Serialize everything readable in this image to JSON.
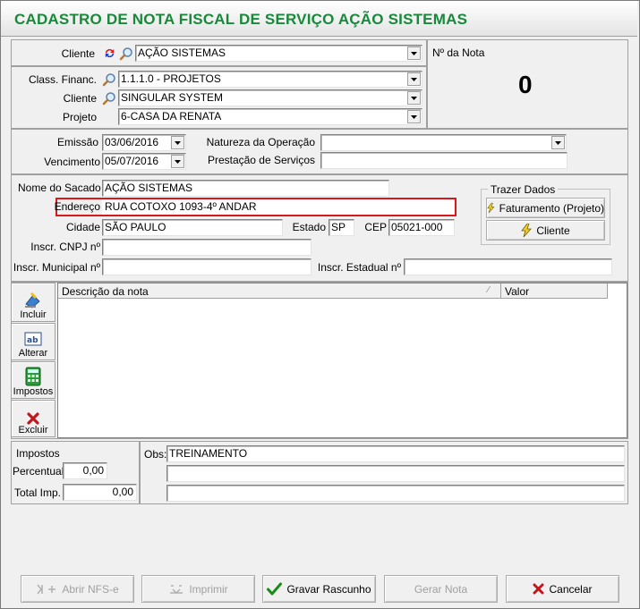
{
  "window": {
    "title": "CADASTRO DE NOTA FISCAL DE SERVIÇO AÇÃO SISTEMAS"
  },
  "header": {
    "cliente_label": "Cliente",
    "cliente_value": "AÇÃO SISTEMAS",
    "nota_label": "Nº da Nota",
    "nota_value": "0"
  },
  "classification": {
    "class_financ_label": "Class. Financ.",
    "class_financ_value": "1.1.1.0 - PROJETOS",
    "cliente_label": "Cliente",
    "cliente_value": "SINGULAR SYSTEM",
    "projeto_label": "Projeto",
    "projeto_value": "6-CASA DA RENATA"
  },
  "dates": {
    "emissao_label": "Emissão",
    "emissao_value": "03/06/2016",
    "vencimento_label": "Vencimento",
    "vencimento_value": "05/07/2016",
    "natureza_label": "Natureza da Operação",
    "natureza_value": "",
    "prestacao_label": "Prestação de Serviços",
    "prestacao_value": ""
  },
  "sacado": {
    "nome_label": "Nome do Sacado",
    "nome_value": "AÇÃO SISTEMAS",
    "endereco_label": "Endereço",
    "endereco_value": "RUA COTOXO 1093-4º ANDAR",
    "cidade_label": "Cidade",
    "cidade_value": "SÃO PAULO",
    "estado_label": "Estado",
    "estado_value": "SP",
    "cep_label": "CEP",
    "cep_value": "05021-000",
    "cnpj_label": "Inscr. CNPJ nº",
    "cnpj_value": "",
    "municipal_label": "Inscr. Municipal nº",
    "municipal_value": "",
    "estadual_label": "Inscr. Estadual nº",
    "estadual_value": ""
  },
  "trazer_dados": {
    "label": "Trazer Dados",
    "faturamento_button": "Faturamento (Projeto)",
    "cliente_button": "Cliente"
  },
  "items": {
    "incluir": "Incluir",
    "alterar": "Alterar",
    "impostos": "Impostos",
    "excluir": "Excluir",
    "col_descricao": "Descrição da nota",
    "col_valor": "Valor",
    "rows": []
  },
  "impostos": {
    "label": "Impostos",
    "percentual_label": "Percentual",
    "percentual_value": "0,00",
    "total_label": "Total Imp.",
    "total_value": "0,00"
  },
  "obs": {
    "label": "Obs:",
    "line1": "TREINAMENTO",
    "line2": "",
    "line3": ""
  },
  "footer": {
    "abrir_nfse": "Abrir NFS-e",
    "imprimir": "Imprimir",
    "gravar_rascunho": "Gravar Rascunho",
    "gerar_nota": "Gerar Nota",
    "cancelar": "Cancelar"
  },
  "colors": {
    "title": "#178a3a",
    "highlight": "#d9181c",
    "ok": "#1a8a1a",
    "cancel": "#c0161c"
  }
}
